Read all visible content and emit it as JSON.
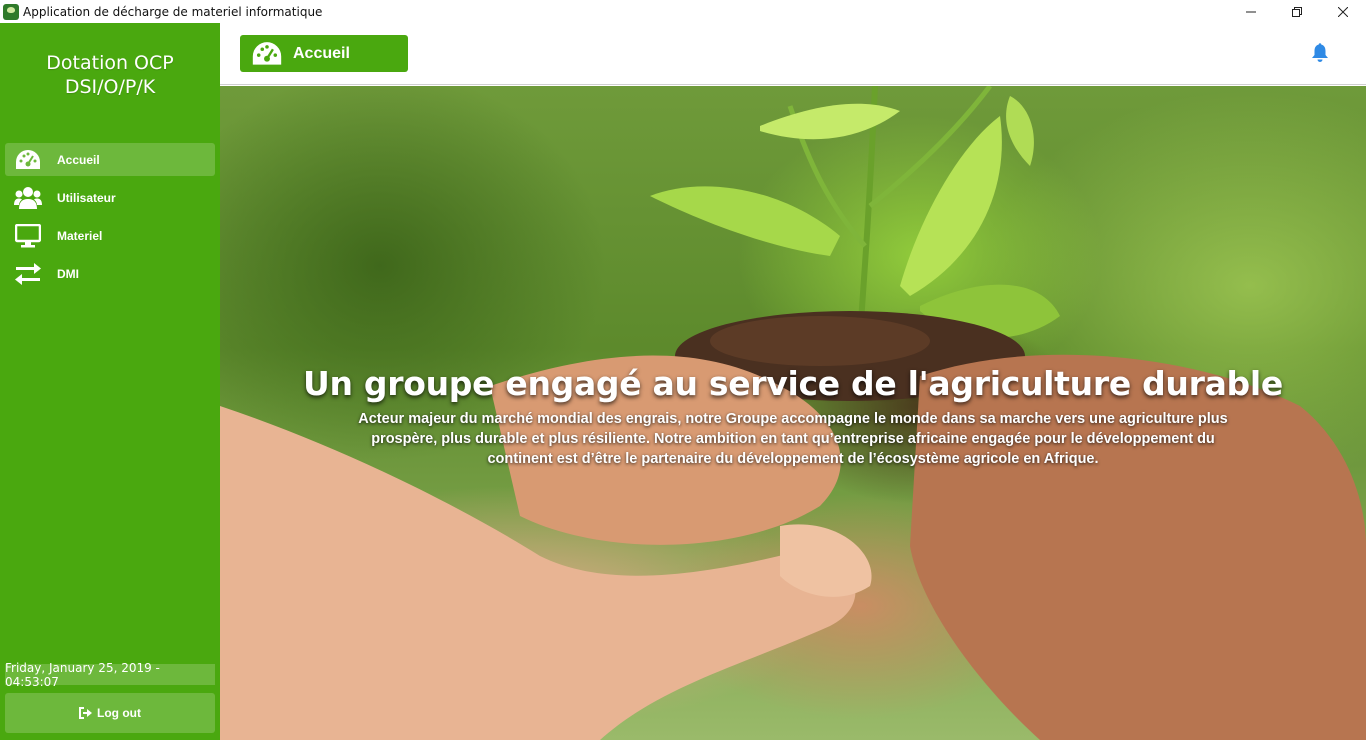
{
  "window": {
    "title": "Application de décharge de materiel informatique",
    "app_icon": "ocp-logo-icon",
    "controls": [
      "minimize-icon",
      "restore-icon",
      "close-icon"
    ]
  },
  "sidebar": {
    "brand_line1": "Dotation OCP",
    "brand_line2": "DSI/O/P/K",
    "items": [
      {
        "label": "Accueil",
        "icon": "dashboard-icon",
        "active": true
      },
      {
        "label": "Utilisateur",
        "icon": "users-icon",
        "active": false
      },
      {
        "label": "Materiel",
        "icon": "monitor-icon",
        "active": false
      },
      {
        "label": "DMI",
        "icon": "exchange-arrows-icon",
        "active": false
      }
    ],
    "datetime": "Friday, January 25, 2019 - 04:53:07",
    "logout_label": "Log out",
    "logout_icon": "sign-out-icon"
  },
  "header": {
    "page_title": "Accueil",
    "page_icon": "dashboard-icon",
    "notification_icon": "bell-icon"
  },
  "hero": {
    "title": "Un groupe engagé au service de l'agriculture durable",
    "line1": "Acteur majeur du marché mondial des engrais, notre Groupe accompagne le monde dans sa marche vers une agriculture plus",
    "line2": "prospère, plus durable et plus résiliente. Notre ambition en tant qu’entreprise africaine engagée pour le développement du",
    "line3": "continent est d’être le partenaire du développement de l’écosystème agricole en Afrique."
  },
  "colors": {
    "brand_green": "#4aa80f",
    "active_green": "#6db83c",
    "bell_blue": "#2f8ae5"
  }
}
